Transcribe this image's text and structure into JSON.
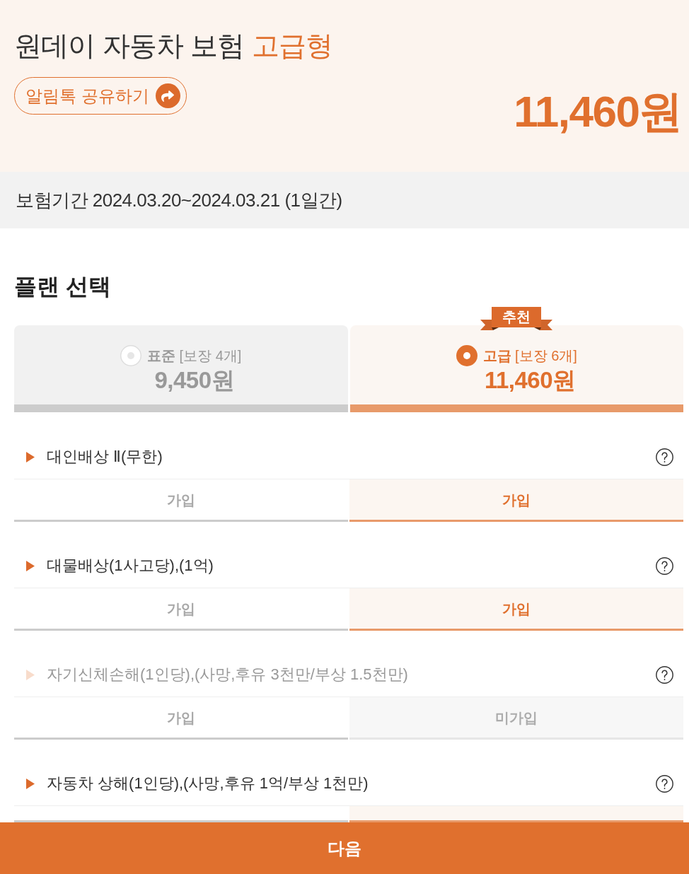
{
  "header": {
    "title": "원데이 자동차 보험",
    "title_highlight": "고급형",
    "share_button": "알림톡 공유하기",
    "price": "11,460원"
  },
  "period": {
    "text": "보험기간 2024.03.20~2024.03.21 (1일간)"
  },
  "plan_section": {
    "title": "플랜 선택",
    "plans": [
      {
        "label": "**표준** [보장 4개]",
        "price": "9,450원",
        "selected": false
      },
      {
        "label": "**고급** [보장 6개]",
        "price": "11,460원",
        "selected": true,
        "badge": "추천"
      }
    ]
  },
  "coverages": [
    {
      "title": "대인배상 Ⅱ(무한)",
      "disabled": false,
      "options": [
        {
          "label": "가입",
          "selected": false,
          "disabled": false
        },
        {
          "label": "가입",
          "selected": true,
          "disabled": false
        }
      ]
    },
    {
      "title": "대물배상(1사고당),(1억)",
      "disabled": false,
      "options": [
        {
          "label": "가입",
          "selected": false,
          "disabled": false
        },
        {
          "label": "가입",
          "selected": true,
          "disabled": false
        }
      ]
    },
    {
      "title": "자기신체손해(1인당),(사망,후유 3천만/부상 1.5천만)",
      "disabled": true,
      "options": [
        {
          "label": "가입",
          "selected": false,
          "disabled": false
        },
        {
          "label": "미가입",
          "selected": false,
          "disabled": true
        }
      ]
    },
    {
      "title": "자동차 상해(1인당),(사망,후유 1억/부상 1천만)",
      "disabled": false,
      "options": [
        {
          "selected": false,
          "disabled": false
        },
        {
          "selected": true,
          "disabled": false
        }
      ]
    }
  ],
  "next_button": "다음"
}
